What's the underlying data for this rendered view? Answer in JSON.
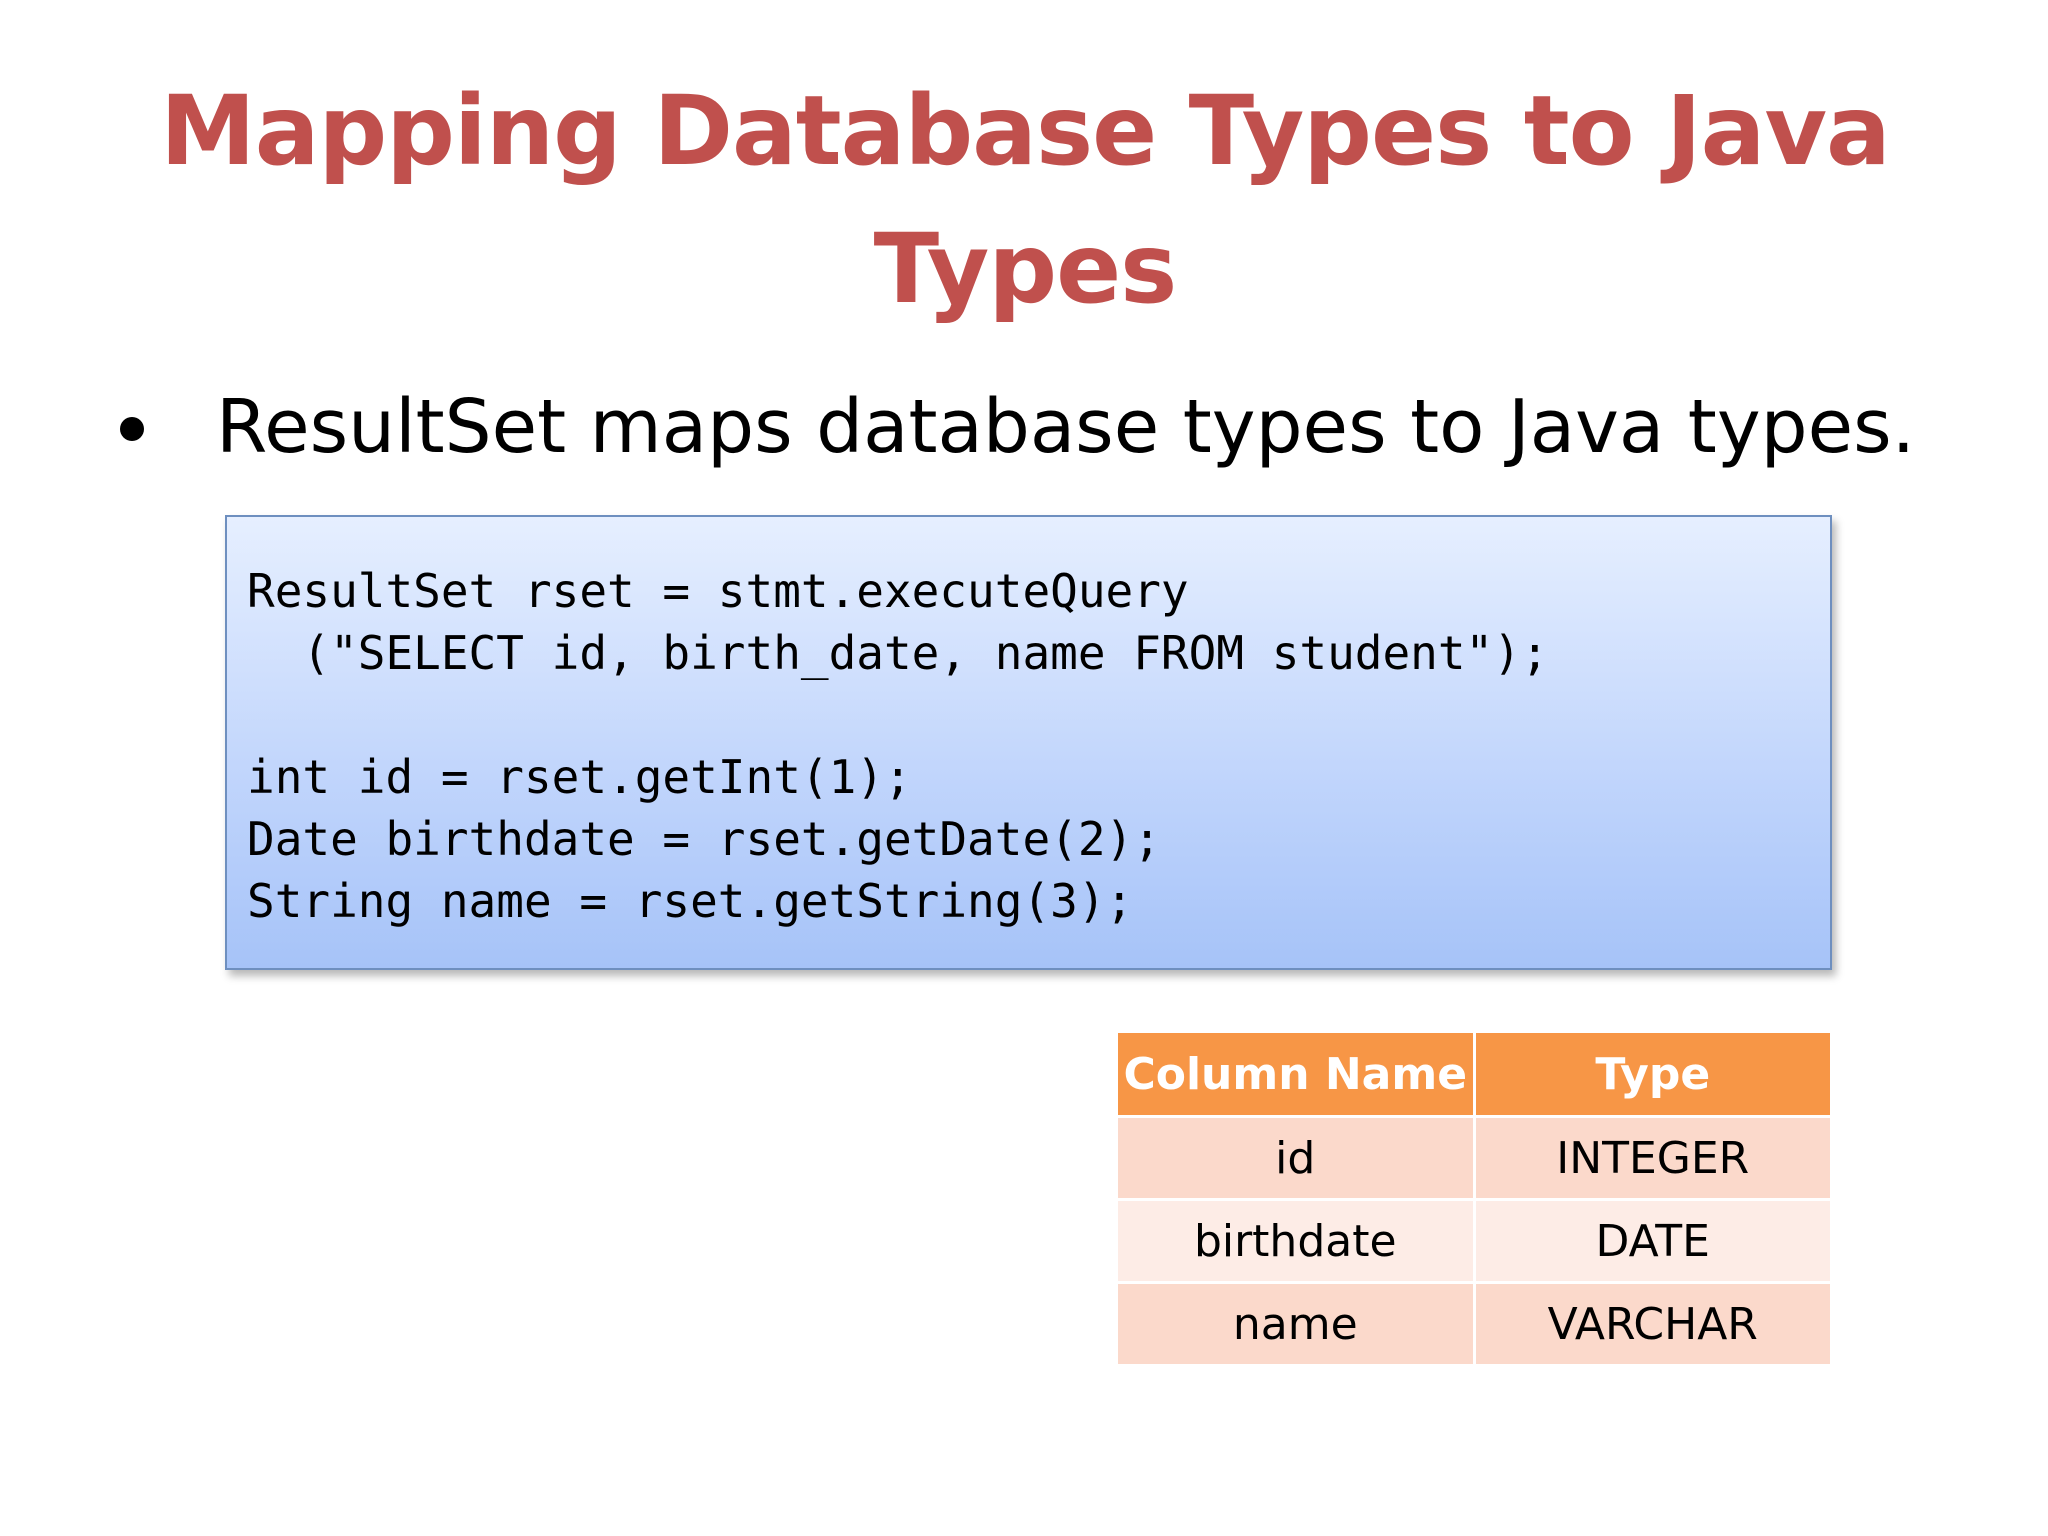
{
  "title": {
    "line1": "Mapping Database Types to Java",
    "line2": "Types"
  },
  "bullet": {
    "text": "ResultSet maps database types to Java types."
  },
  "code": {
    "lines": [
      "ResultSet rset = stmt.executeQuery",
      "  (\"SELECT id, birth_date, name FROM student\");",
      "",
      "int id = rset.getInt(1);",
      "Date birthdate = rset.getDate(2);",
      "String name = rset.getString(3);"
    ]
  },
  "table": {
    "headers": [
      "Column Name",
      "Type"
    ],
    "rows": [
      [
        "id",
        "INTEGER"
      ],
      [
        "birthdate",
        "DATE"
      ],
      [
        "name",
        "VARCHAR"
      ]
    ]
  },
  "colors": {
    "title": "#c0504d",
    "table_header": "#f79646",
    "table_row_odd": "#fbd9cb",
    "table_row_even": "#fdece6",
    "code_bg_top": "#e6efff",
    "code_bg_bottom": "#a6c3f8"
  }
}
